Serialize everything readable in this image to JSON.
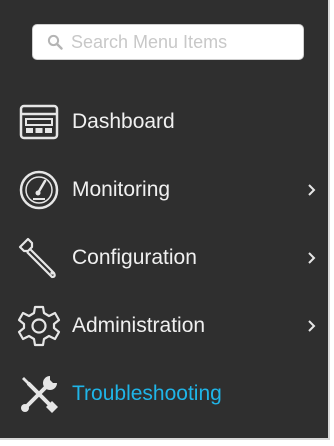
{
  "search": {
    "placeholder": "Search Menu Items",
    "icon": "search-icon"
  },
  "menu": {
    "items": [
      {
        "label": "Dashboard",
        "icon": "dashboard-icon",
        "has_submenu": false,
        "active": false
      },
      {
        "label": "Monitoring",
        "icon": "gauge-icon",
        "has_submenu": true,
        "active": false
      },
      {
        "label": "Configuration",
        "icon": "wrench-icon",
        "has_submenu": true,
        "active": false
      },
      {
        "label": "Administration",
        "icon": "gear-icon",
        "has_submenu": true,
        "active": false
      },
      {
        "label": "Troubleshooting",
        "icon": "tools-icon",
        "has_submenu": false,
        "active": true
      }
    ]
  },
  "colors": {
    "background": "#2f2f2f",
    "text": "#f0f0f0",
    "active_text": "#1fb5e8",
    "icon": "#e6e6e6"
  }
}
